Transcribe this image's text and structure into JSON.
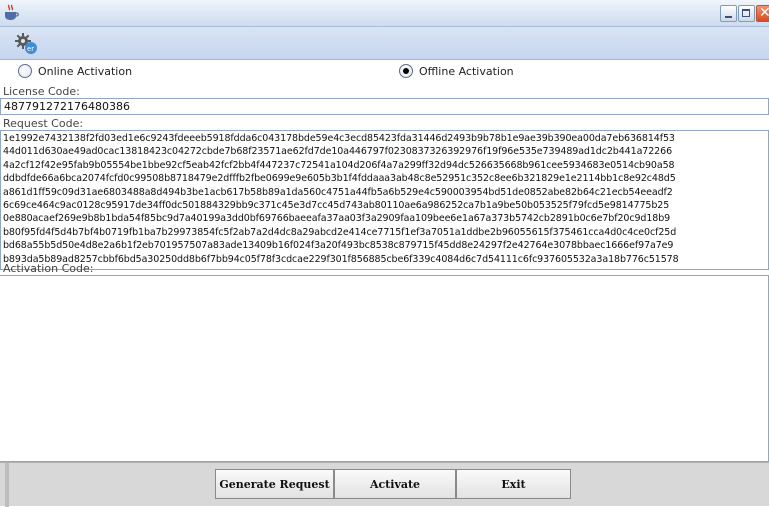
{
  "window": {
    "title": "",
    "controls": [
      "minimize",
      "maximize",
      "close"
    ],
    "close_glyph": "✕"
  },
  "toolbar": {
    "icon": "gear-icon"
  },
  "activation_mode": {
    "options": [
      {
        "label": "Online Activation",
        "selected": false
      },
      {
        "label": "Offline Activation",
        "selected": true
      }
    ]
  },
  "license": {
    "label": "License Code:",
    "value": "487791272176480386"
  },
  "request": {
    "label": "Request Code:",
    "lines": [
      "1e1992e7432138f2fd03ed1e6c9243fdeeeb5918fdda6c043178bde59e4c3ecd85423fda31446d2493b9b78b1e9ae39b390ea00da7eb636814f53",
      "44d011d630ae49ad0cac13818423c04272cbde7b68f23571ae62fd7de10a446797f0230837326392976f19f96e535e739489ad1dc2b441a72266",
      "4a2cf12f42e95fab9b05554be1bbe92cf5eab42fcf2bb4f447237c72541a104d206f4a7a299ff32d94dc526635668b961cee5934683e0514cb90a58",
      "ddbdfde66a6bca2074fcfd0c99508b8718479e2dfffb2fbe0699e9e605b3b1f4fddaaa3ab48c8e52951c352c8ee6b321829e1e2114bb1c8e92c48d5",
      "a861d1ff59c09d31ae6803488a8d494b3be1acb617b58b89a1da560c4751a44fb5a6b529e4c590003954bd51de0852abe82b64c21ecb54eeadf2",
      "6c69ce464c9ac0128c95917de34ff0dc501884329bb9c371c45e3d7cc45d743ab80110ae6a986252ca7b1a9be50b053525f79fcd5e9814775b25",
      "0e880acaef269e9b8b1bda54f85bc9d7a40199a3dd0bf69766baeeafa37aa03f3a2909faa109bee6e1a67a373b5742cb2891b0c6e7bf20c9d18b9",
      "b80f95fd4f5d4b7bf4b0719fb1ba7b29973854fc5f2ab7a2d4dc8a29abcd2e414ce7715f1ef3a7051a1ddbe2b96055615f375461cca4d0c4ce0cf25d",
      "bd68a55b5d50e4d8e2a6b1f2eb701957507a83ade13409b16f024f3a20f493bc8538c879715f45dd8e24297f2e42764e3078bbaec1666ef97a7e9",
      "b893da5b89ad8257cbbf6bd5a30250dd8b6f7bb94c05f78f3cdcae229f301f856885cbe6f339c4084d6c7d54111c6fc937605532a3a18b776c51578"
    ]
  },
  "activation": {
    "label": "Activation Code:",
    "value": ""
  },
  "buttons": {
    "generate": "Generate Request",
    "activate": "Activate",
    "exit": "Exit"
  }
}
